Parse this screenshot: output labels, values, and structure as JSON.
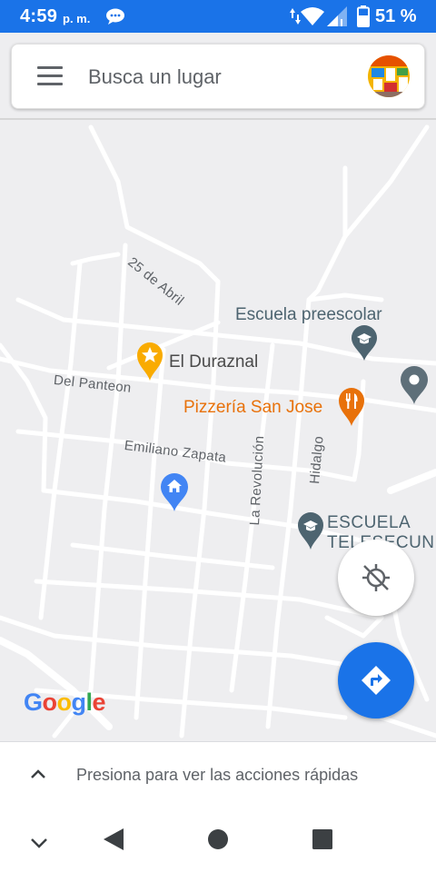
{
  "status_bar": {
    "time": "4:59",
    "ampm": "p. m.",
    "battery": "51 %",
    "icons": [
      "message-icon",
      "data-arrows-icon",
      "wifi-icon",
      "signal-icon",
      "battery-icon"
    ]
  },
  "search": {
    "placeholder": "Busca un lugar",
    "menu_icon": "menu-icon",
    "avatar": "profile-avatar"
  },
  "map": {
    "streets": [
      "25 de Abril",
      "Del Panteon",
      "Emiliano Zapata",
      "La Revolución",
      "Hidalgo"
    ],
    "places": [
      {
        "name": "Escuela preescolar",
        "icon": "school-icon"
      },
      {
        "name": "El Duraznal",
        "icon": "star-icon"
      },
      {
        "name": "Pizzería San Jose",
        "icon": "restaurant-icon"
      },
      {
        "name": "ESCUELA",
        "icon": "school-icon"
      },
      {
        "name": "TELESECUND",
        "icon": "school-icon"
      }
    ],
    "home_icon": "home-icon",
    "logo": "Google",
    "colors": {
      "road": "#ffffff",
      "land": "#eeeef0",
      "school": "#4d6470",
      "food": "#e8710a",
      "favorite": "#f9ab00",
      "home": "#4285f4",
      "accent": "#1a73e8"
    }
  },
  "controls": {
    "location_button": "crosshair-off-icon",
    "directions_button": "directions-icon"
  },
  "bottom_sheet": {
    "text": "Presiona para ver las acciones rápidas"
  },
  "nav_bar": {
    "buttons": [
      "chevron-down-icon",
      "back-icon",
      "home-circle-icon",
      "recents-square-icon"
    ]
  }
}
